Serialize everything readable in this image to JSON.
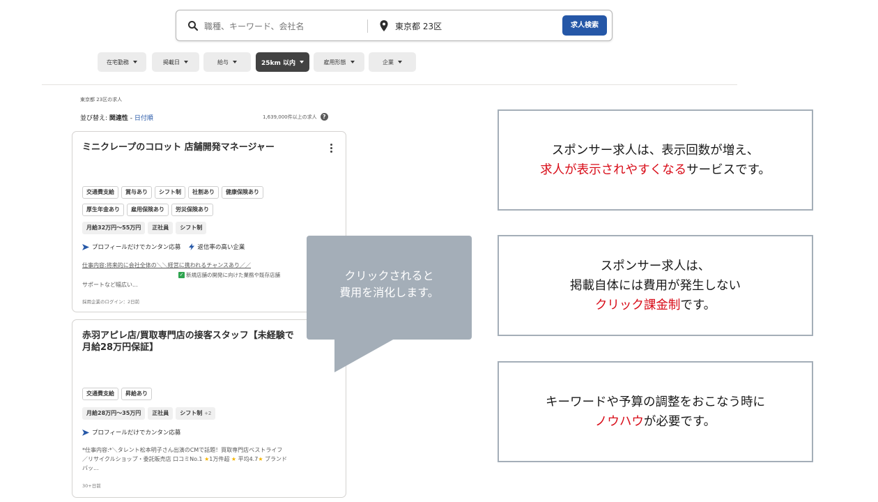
{
  "search": {
    "keyword_placeholder": "職種、キーワード、会社名",
    "location_value": "東京都 23区",
    "button_label": "求人検索"
  },
  "filters": [
    {
      "label": "在宅勤務",
      "active": false
    },
    {
      "label": "掲載日",
      "active": false
    },
    {
      "label": "給与",
      "active": false
    },
    {
      "label": "25km 以内",
      "active": true
    },
    {
      "label": "雇用形態",
      "active": false
    },
    {
      "label": "企業",
      "active": false
    }
  ],
  "results": {
    "location_heading": "東京都 23区の求人",
    "sort_prefix": "並び替え: ",
    "sort_active": "関連性",
    "sort_separator": " - ",
    "sort_alt": "日付順",
    "count": "1,639,000件以上の求人",
    "help": "?"
  },
  "jobs": [
    {
      "title": "ミニクレープのコロット 店舗開発マネージャー",
      "tags_row1": [
        "交通費支給",
        "賞与あり",
        "シフト制",
        "社割あり",
        "健康保険あり"
      ],
      "tags_row2": [
        "厚生年金あり",
        "雇用保険あり",
        "労災保険あり"
      ],
      "salary_tags": [
        "月給32万円～55万円",
        "正社員",
        "シフト制"
      ],
      "apply_label": "プロフィールだけでカンタン応募",
      "response_label": "返信率の高い企業",
      "snippet_line1": "仕事内容:将来的に会社全体の＼＼経営に携われるチャンスあり／／",
      "snippet_check": "新規店舗の開発に向けた業務や既存店舗",
      "snippet_line3": "サポートなど幅広い...",
      "meta": "採用企業のログイン：2日前"
    },
    {
      "title": "赤羽アピレ店/買取専門店の接客スタッフ【未経験で",
      "title_line2": "月給28万円保証】",
      "tags_row1": [
        "交通費支給",
        "昇給あり"
      ],
      "salary_tags": [
        "月給28万円～35万円",
        "正社員",
        "シフト制"
      ],
      "salary_more": "+2",
      "apply_label": "プロフィールだけでカンタン応募",
      "snippet_line1": "*仕事内容:*＼タレント松本明子さん出演のCMで話題！買取専門店ベストライフ",
      "snippet_line2a": "／リサイクルショップ・委託販売店 口コミNo.1",
      "snippet_line2b": "1万件超",
      "snippet_line2c": "平均4.7",
      "snippet_line2d": "ブランド",
      "snippet_line3": "バッ...",
      "meta": "30+日前"
    }
  ],
  "tooltip": {
    "line1": "クリックされると",
    "line2": "費用を消化します。"
  },
  "info_boxes": {
    "box1": {
      "line1": "スポンサー求人は、表示回数が増え、",
      "line2_red": "求人が表示されやすくなる",
      "line2_rest": "サービスです。"
    },
    "box2": {
      "line1": "スポンサー求人は、",
      "line2": "掲載自体には費用が発生しない",
      "line3_red": "クリック課金制",
      "line3_rest": "です。"
    },
    "box3": {
      "line1": "キーワードや予算の調整をおこなう時に",
      "line2_red": "ノウハウ",
      "line2_rest": "が必要です。"
    }
  },
  "colors": {
    "accent_blue": "#2557a7",
    "highlight_red": "#d80c18",
    "tooltip_gray": "#a4aeb8",
    "active_chip": "#424242"
  }
}
